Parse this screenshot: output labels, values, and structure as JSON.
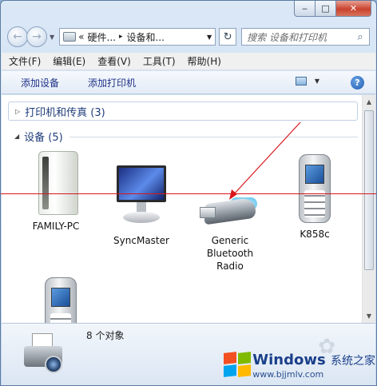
{
  "window": {
    "caption": {
      "minimize": "‒",
      "maximize": "□",
      "close": "✕"
    }
  },
  "navbar": {
    "back_glyph": "←",
    "forward_glyph": "→",
    "dropdown_glyph": "▼",
    "address": {
      "overflow": "«",
      "parts": [
        "硬件...",
        "设备和..."
      ],
      "separator": "▸"
    },
    "refresh_glyph": "↻",
    "search_placeholder": "搜索 设备和打印机",
    "search_icon": "search-icon"
  },
  "menubar": {
    "items": [
      "文件(F)",
      "编辑(E)",
      "查看(V)",
      "工具(T)",
      "帮助(H)"
    ]
  },
  "cmdbar": {
    "add_device": "添加设备",
    "add_printer": "添加打印机",
    "help_glyph": "?"
  },
  "content": {
    "printers_group": {
      "arrow": "▷",
      "title": "打印机和传真 (3)"
    },
    "devices_group": {
      "arrow": "◢",
      "title": "设备 (5)"
    },
    "devices": [
      {
        "label": "FAMILY-PC",
        "icon": "nas-drive-icon"
      },
      {
        "label": "SyncMaster",
        "icon": "monitor-icon"
      },
      {
        "label": "Generic Bluetooth Radio",
        "icon": "usb-bluetooth-icon"
      },
      {
        "label": "K858c",
        "icon": "mobile-phone-icon"
      },
      {
        "label": "",
        "icon": "mobile-phone-icon"
      }
    ],
    "annotation_color": "#d8161c"
  },
  "details": {
    "count": "8 个对象",
    "icon": "printer-camera-icon"
  },
  "watermark": {
    "brand": "Windows",
    "brand_cn": "系统之家",
    "url": "www.bjjmlv.com"
  }
}
